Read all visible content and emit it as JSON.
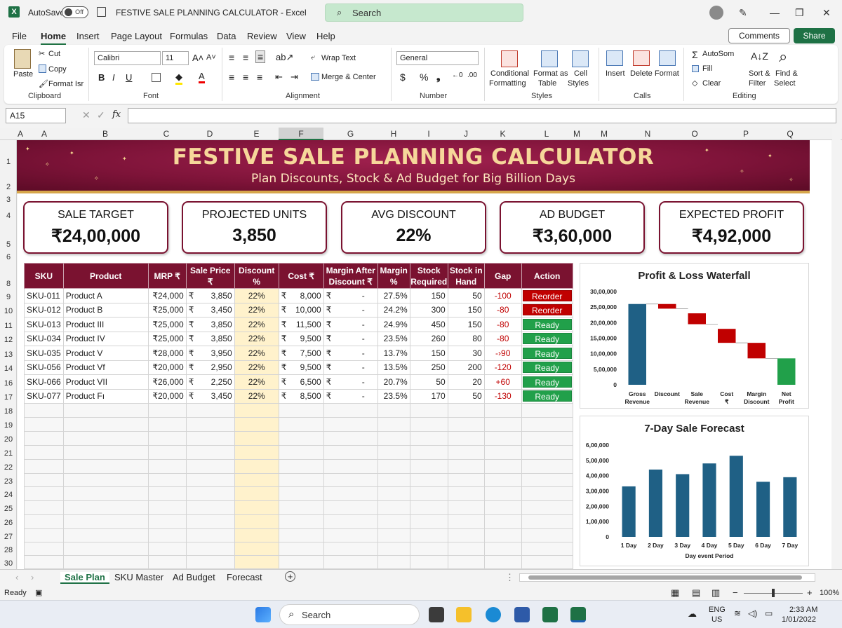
{
  "titlebar": {
    "autosave_label": "AutoSave",
    "autosave_state": "Off",
    "document_title": "FESTIVE SALE PLANNING CALCULATOR - Excel",
    "search_placeholder": "Search"
  },
  "menu": {
    "items": [
      "File",
      "Home",
      "Insert",
      "Page Layout",
      "Formulas",
      "Data",
      "Review",
      "View",
      "Help"
    ],
    "comments_label": "Comments",
    "share_label": "Share"
  },
  "ribbon": {
    "clipboard": {
      "paste": "Paste",
      "cut": "Cut",
      "copy": "Copy",
      "format_painter": "Format Isr",
      "group": "Clipboard"
    },
    "font": {
      "name": "Calibri",
      "size": "11",
      "group": "Font"
    },
    "alignment": {
      "wrap_text": "Wrap Text",
      "merge_center": "Merge & Center",
      "group": "Alignment"
    },
    "number": {
      "format": "General",
      "group": "Number"
    },
    "styles": {
      "conditional": "Conditional",
      "conditional2": "Formatting",
      "format_as": "Format as",
      "format_as2": "Table",
      "cell": "Cell",
      "cell2": "Styles",
      "group": "Styles"
    },
    "cells": {
      "insert": "Insert",
      "delete": "Delete",
      "format": "Format",
      "group": "Calls"
    },
    "editing": {
      "autosum": "AutoSom",
      "fill": "Fill",
      "clear": "Clear",
      "sort": "Sort &",
      "sort2": "Filter",
      "find": "Find &",
      "find2": "Select",
      "group": "Editing"
    }
  },
  "formula_bar": {
    "cell_ref": "A15",
    "fx": "fx",
    "formula": ""
  },
  "columns": [
    "A",
    "A",
    "B",
    "C",
    "D",
    "E",
    "F",
    "G",
    "H",
    "I",
    "J",
    "K",
    "L",
    "M",
    "M",
    "N",
    "O",
    "P",
    "Q"
  ],
  "rows": [
    "1",
    "2",
    "3",
    "4",
    "5",
    "6",
    "8",
    "9",
    "10",
    "11",
    "12",
    "13",
    "14",
    "16",
    "17",
    "18",
    "19",
    "20",
    "21",
    "22",
    "23",
    "24",
    "25",
    "26",
    "27",
    "28",
    "30"
  ],
  "banner": {
    "title": "FESTIVE SALE PLANNING CALCULATOR",
    "subtitle": "Plan Discounts, Stock & Ad Budget for Big Billion Days"
  },
  "kpis": [
    {
      "label": "SALE TARGET",
      "value": "₹24,00,000"
    },
    {
      "label": "PROJECTED UNITS",
      "value": "3,850"
    },
    {
      "label": "AVG DISCOUNT",
      "value": "22%"
    },
    {
      "label": "AD BUDGET",
      "value": "₹3,60,000"
    },
    {
      "label": "EXPECTED PROFIT",
      "value": "₹4,92,000"
    }
  ],
  "table": {
    "headers": [
      "SKU",
      "Product",
      "MRP ₹",
      "Sale Price ₹",
      "Discount %",
      "Cost ₹",
      "Margin After Discount ₹",
      "Margin %",
      "Stock Required",
      "Stock in Hand",
      "Gap",
      "Action"
    ],
    "rows": [
      {
        "sku": "SKU-011",
        "product": "Product A",
        "mrp": "₹24,000",
        "sale": "3,850",
        "disc": "22%",
        "cost": "8,000",
        "margin": "-",
        "mpct": "27.5%",
        "req": "150",
        "hand": "50",
        "gap": "-100",
        "action": "Reorder"
      },
      {
        "sku": "SKU-012",
        "product": "Product B",
        "mrp": "₹25,000",
        "sale": "3,450",
        "disc": "22%",
        "cost": "10,000",
        "margin": "-",
        "mpct": "24.2%",
        "req": "300",
        "hand": "150",
        "gap": "-80",
        "action": "Reorder"
      },
      {
        "sku": "SKU-013",
        "product": "Product III",
        "mrp": "₹25,000",
        "sale": "3,850",
        "disc": "22%",
        "cost": "11,500",
        "margin": "-",
        "mpct": "24.9%",
        "req": "450",
        "hand": "150",
        "gap": "-80",
        "action": "Ready"
      },
      {
        "sku": "SKU-034",
        "product": "Product IV",
        "mrp": "₹25,000",
        "sale": "3,850",
        "disc": "22%",
        "cost": "9,500",
        "margin": "-",
        "mpct": "23.5%",
        "req": "260",
        "hand": "80",
        "gap": "-80",
        "action": "Ready"
      },
      {
        "sku": "SKU-035",
        "product": "Product V",
        "mrp": "₹28,000",
        "sale": "3,950",
        "disc": "22%",
        "cost": "7,500",
        "margin": "-",
        "mpct": "13.7%",
        "req": "150",
        "hand": "30",
        "gap": "-›90",
        "action": "Ready"
      },
      {
        "sku": "SKU-056",
        "product": "Product Vf",
        "mrp": "₹20,000",
        "sale": "2,950",
        "disc": "22%",
        "cost": "9,500",
        "margin": "-",
        "mpct": "13.5%",
        "req": "250",
        "hand": "200",
        "gap": "-120",
        "action": "Ready"
      },
      {
        "sku": "SKU-066",
        "product": "Product VII",
        "mrp": "₹26,000",
        "sale": "2,250",
        "disc": "22%",
        "cost": "6,500",
        "margin": "-",
        "mpct": "20.7%",
        "req": "50",
        "hand": "20",
        "gap": "+60",
        "action": "Ready"
      },
      {
        "sku": "SKU-077",
        "product": "Product Fı",
        "mrp": "₹20,000",
        "sale": "3,450",
        "disc": "22%",
        "cost": "8,500",
        "margin": "-",
        "mpct": "23.5%",
        "req": "170",
        "hand": "50",
        "gap": "-130",
        "action": "Ready"
      }
    ],
    "currency_symbol": "₹"
  },
  "colors": {
    "primary": "#7a1230",
    "reorder": "#c00000",
    "ready": "#21a04a",
    "bar": "#1f6085",
    "gold": "#f6d79a",
    "excel_green": "#1e7145",
    "waterfall_up": "#21a04a",
    "waterfall_down": "#c00000"
  },
  "chart_data": [
    {
      "type": "bar",
      "title": "Profit & Loss Waterfall",
      "categories": [
        "Gross Revenue",
        "Discount",
        "Sale Revenue",
        "Cost ₹",
        "Margin Discount",
        "Net Profit"
      ],
      "waterfall": [
        {
          "start": 0,
          "end": 2600000,
          "kind": "total"
        },
        {
          "start": 2600000,
          "end": 2450000,
          "kind": "decrease"
        },
        {
          "start": 2300000,
          "end": 1950000,
          "kind": "decrease"
        },
        {
          "start": 1800000,
          "end": 1350000,
          "kind": "decrease"
        },
        {
          "start": 1350000,
          "end": 850000,
          "kind": "decrease"
        },
        {
          "start": 0,
          "end": 850000,
          "kind": "increase"
        }
      ],
      "yticks": [
        "30,00,000",
        "25,00,000",
        "20,00,000",
        "15,00,000",
        "10,00,000",
        "5,00,000",
        "0"
      ],
      "ylim": [
        0,
        3000000
      ],
      "xlabel": "",
      "ylabel": ""
    },
    {
      "type": "bar",
      "title": "7-Day Sale Forecast",
      "categories": [
        "1 Day",
        "2 Day",
        "3 Day",
        "4 Day",
        "5 Day",
        "6 Day",
        "7 Day"
      ],
      "values": [
        330000,
        440000,
        410000,
        480000,
        530000,
        360000,
        390000
      ],
      "yticks": [
        "6,00,000",
        "5,00,000",
        "4,00,000",
        "3,00,000",
        "2,00,000",
        "1,00,000",
        "0"
      ],
      "ylim": [
        0,
        600000
      ],
      "xlabel": "Day event Period",
      "ylabel": ""
    }
  ],
  "tabs": [
    "Sale Plan",
    "SKU Master",
    "Ad Budget",
    "Forecast"
  ],
  "status": {
    "ready": "Ready",
    "zoom": "100%"
  },
  "taskbar": {
    "search": "Search",
    "lang1": "ENG",
    "lang2": "US",
    "time": "2:33 AM",
    "date": "1/01/2022"
  }
}
